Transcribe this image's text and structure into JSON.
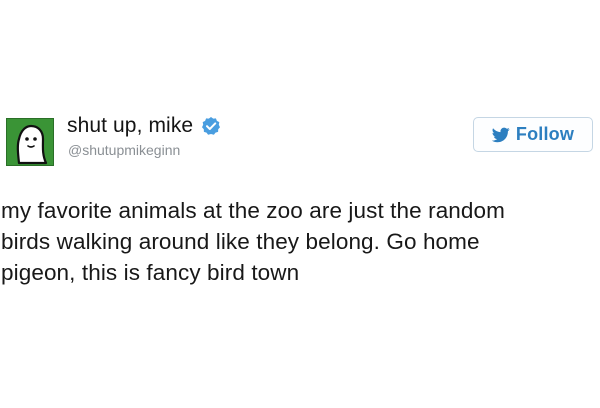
{
  "tweet": {
    "author": {
      "display_name": "shut up, mike",
      "handle": "@shutupmikeginn",
      "avatar_icon": "cartoon-ghost-avatar",
      "verified": true,
      "verified_icon": "verified-badge-icon"
    },
    "follow_button": {
      "label": "Follow",
      "icon": "twitter-bird-icon"
    },
    "text_lines": [
      "my favorite animals at the zoo are just the random",
      "birds walking around like they belong. Go home",
      "pigeon, this is fancy bird town"
    ]
  },
  "colors": {
    "accent": "#2d7fc0",
    "verified_badge": "#4a9ee0",
    "avatar_background": "#3a9436",
    "handle_text": "#8a8f94",
    "button_border": "#c5d6e4"
  }
}
